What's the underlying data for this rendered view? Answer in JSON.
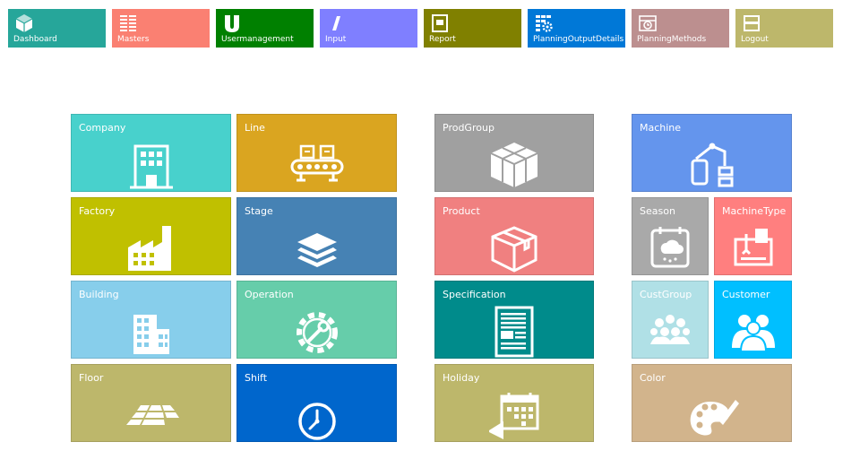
{
  "nav": [
    {
      "label": "Dashboard",
      "icon": "cube-icon",
      "color": "#26a69a"
    },
    {
      "label": "Masters",
      "icon": "masters-grid-icon",
      "color": "#fa8072"
    },
    {
      "label": "Usermanagement",
      "icon": "user-u-icon",
      "color": "#008000"
    },
    {
      "label": "Input",
      "icon": "input-cursor-icon",
      "color": "#7f7fff"
    },
    {
      "label": "Report",
      "icon": "report-icon",
      "color": "#808000"
    },
    {
      "label": "PlanningOutputDetails",
      "icon": "planning-grid-gear-icon",
      "color": "#0078d7"
    },
    {
      "label": "PlanningMethods",
      "icon": "planning-methods-icon",
      "color": "#bc8f8f"
    },
    {
      "label": "Logout",
      "icon": "logout-icon",
      "color": "#bdb76b"
    }
  ],
  "tiles": {
    "company": {
      "label": "Company",
      "icon": "office-building-icon",
      "color": "#48d1cc"
    },
    "line": {
      "label": "Line",
      "icon": "conveyor-belt-icon",
      "color": "#daa520"
    },
    "factory": {
      "label": "Factory",
      "icon": "factory-icon",
      "color": "#c0c000"
    },
    "stage": {
      "label": "Stage",
      "icon": "layers-icon",
      "color": "#4682b4"
    },
    "building": {
      "label": "Building",
      "icon": "city-building-icon",
      "color": "#87ceeb"
    },
    "operation": {
      "label": "Operation",
      "icon": "wrench-gear-icon",
      "color": "#66cdaa"
    },
    "floor": {
      "label": "Floor",
      "icon": "floor-tiles-icon",
      "color": "#bdb76b"
    },
    "shift": {
      "label": "Shift",
      "icon": "clock-icon",
      "color": "#0066cc"
    },
    "prodgroup": {
      "label": "ProdGroup",
      "icon": "boxes-icon",
      "color": "#a0a0a0"
    },
    "product": {
      "label": "Product",
      "icon": "package-box-icon",
      "color": "#f08080"
    },
    "specification": {
      "label": "Specification",
      "icon": "document-icon",
      "color": "#008b8b"
    },
    "holiday": {
      "label": "Holiday",
      "icon": "calendar-megaphone-icon",
      "color": "#bdb76b"
    },
    "machine": {
      "label": "Machine",
      "icon": "robot-arm-icon",
      "color": "#6495ed"
    },
    "season": {
      "label": "Season",
      "icon": "weather-calendar-icon",
      "color": "#a9a9a9"
    },
    "machinetype": {
      "label": "MachineType",
      "icon": "machine-type-icon",
      "color": "#ff7f7f"
    },
    "custgroup": {
      "label": "CustGroup",
      "icon": "crowd-icon",
      "color": "#b0e0e6"
    },
    "customer": {
      "label": "Customer",
      "icon": "customers-icon",
      "color": "#00bfff"
    },
    "color": {
      "label": "Color",
      "icon": "palette-icon",
      "color": "#d2b48c"
    }
  }
}
